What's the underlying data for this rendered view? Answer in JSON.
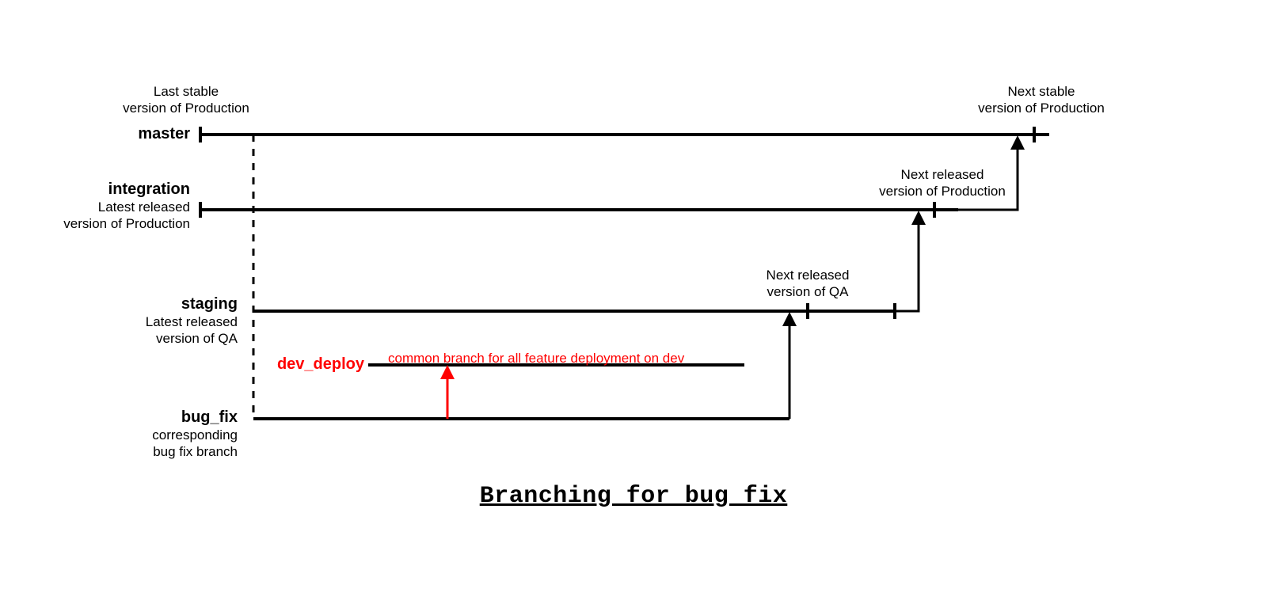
{
  "branches": {
    "master": {
      "name": "master"
    },
    "integration": {
      "name": "integration",
      "note1": "Latest released",
      "note2": "version of Production"
    },
    "staging": {
      "name": "staging",
      "note1": "Latest released",
      "note2": "version of QA"
    },
    "dev_deploy": {
      "name": "dev_deploy",
      "caption": "common branch for all feature deployment on dev"
    },
    "bug_fix": {
      "name": "bug_fix",
      "note1": "corresponding",
      "note2": "bug fix branch"
    }
  },
  "annotations": {
    "last_stable_1": "Last stable",
    "last_stable_2": "version of Production",
    "next_stable_1": "Next stable",
    "next_stable_2": "version of Production",
    "next_released_prod_1": "Next released",
    "next_released_prod_2": "version of Production",
    "next_released_qa_1": "Next released",
    "next_released_qa_2": "version of QA"
  },
  "title": "Branching for bug fix",
  "colors": {
    "black": "#000000",
    "red": "#ff0000"
  }
}
